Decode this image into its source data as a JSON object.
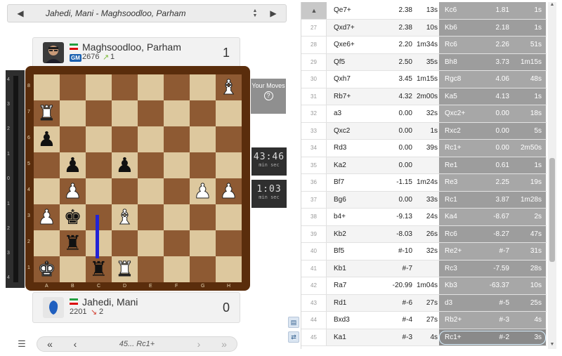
{
  "header": {
    "title": "Jahedi, Mani - Maghsoodloo, Parham",
    "prev_icon": "triangle-left-icon",
    "next_icon": "triangle-right-icon"
  },
  "players": {
    "top": {
      "name": "Maghsoodloo, Parham",
      "title": "GM",
      "rating": "2676",
      "rating_change": "1",
      "score": "1",
      "change_color": "#7dbb3a"
    },
    "bottom": {
      "name": "Jahedi, Mani",
      "rating": "2201",
      "rating_change": "2",
      "score": "0",
      "change_color": "#d23c2c"
    }
  },
  "eval_bar": {
    "labels": [
      "4",
      "3",
      "2",
      "1",
      "0",
      "1",
      "2",
      "3",
      "4"
    ]
  },
  "board": {
    "files": [
      "A",
      "B",
      "C",
      "D",
      "E",
      "F",
      "G",
      "H"
    ],
    "ranks": [
      "8",
      "7",
      "6",
      "5",
      "4",
      "3",
      "2",
      "1"
    ],
    "pieces": [
      {
        "sq": "h8",
        "p": "♝",
        "c": "w"
      },
      {
        "sq": "a7",
        "p": "♜",
        "c": "w"
      },
      {
        "sq": "a6",
        "p": "♟",
        "c": "b"
      },
      {
        "sq": "b5",
        "p": "♟",
        "c": "b"
      },
      {
        "sq": "d5",
        "p": "♟",
        "c": "b"
      },
      {
        "sq": "b4",
        "p": "♟",
        "c": "w"
      },
      {
        "sq": "g4",
        "p": "♟",
        "c": "w"
      },
      {
        "sq": "h4",
        "p": "♟",
        "c": "w"
      },
      {
        "sq": "a3",
        "p": "♟",
        "c": "w"
      },
      {
        "sq": "b3",
        "p": "♚",
        "c": "b"
      },
      {
        "sq": "d3",
        "p": "♝",
        "c": "w"
      },
      {
        "sq": "b2",
        "p": "♜",
        "c": "b"
      },
      {
        "sq": "a1",
        "p": "♚",
        "c": "w"
      },
      {
        "sq": "c1",
        "p": "♜",
        "c": "b"
      },
      {
        "sq": "d1",
        "p": "♜",
        "c": "w"
      }
    ]
  },
  "your_moves": {
    "label": "Your Moves",
    "help": "?"
  },
  "clocks": [
    {
      "time": "43:46",
      "units": "min   sec"
    },
    {
      "time": "1:03",
      "units": "min   sec"
    }
  ],
  "bottom_nav": {
    "current": "45... Rc1+"
  },
  "moves": [
    {
      "n": "",
      "w": "Qe7+",
      "we": "2.38",
      "wt": "13s",
      "b": "Kc6",
      "be": "1.81",
      "bt": "1s"
    },
    {
      "n": "27",
      "w": "Qxd7+",
      "we": "2.38",
      "wt": "10s",
      "b": "Kb6",
      "be": "2.18",
      "bt": "1s"
    },
    {
      "n": "28",
      "w": "Qxe6+",
      "we": "2.20",
      "wt": "1m34s",
      "b": "Rc6",
      "be": "2.26",
      "bt": "51s"
    },
    {
      "n": "29",
      "w": "Qf5",
      "we": "2.50",
      "wt": "35s",
      "b": "Bh8",
      "be": "3.73",
      "bt": "1m15s"
    },
    {
      "n": "30",
      "w": "Qxh7",
      "we": "3.45",
      "wt": "1m15s",
      "b": "Rgc8",
      "be": "4.06",
      "bt": "48s"
    },
    {
      "n": "31",
      "w": "Rb7+",
      "we": "4.32",
      "wt": "2m00s",
      "b": "Ka5",
      "be": "4.13",
      "bt": "1s"
    },
    {
      "n": "32",
      "w": "a3",
      "we": "0.00",
      "wt": "32s",
      "b": "Qxc2+",
      "be": "0.00",
      "bt": "18s"
    },
    {
      "n": "33",
      "w": "Qxc2",
      "we": "0.00",
      "wt": "1s",
      "b": "Rxc2",
      "be": "0.00",
      "bt": "5s"
    },
    {
      "n": "34",
      "w": "Rd3",
      "we": "0.00",
      "wt": "39s",
      "b": "Rc1+",
      "be": "0.00",
      "bt": "2m50s"
    },
    {
      "n": "35",
      "w": "Ka2",
      "we": "0.00",
      "wt": "",
      "b": "Re1",
      "be": "0.61",
      "bt": "1s"
    },
    {
      "n": "36",
      "w": "Bf7",
      "we": "-1.15",
      "wt": "1m24s",
      "b": "Re3",
      "be": "2.25",
      "bt": "19s"
    },
    {
      "n": "37",
      "w": "Bg6",
      "we": "0.00",
      "wt": "33s",
      "b": "Rc1",
      "be": "3.87",
      "bt": "1m28s"
    },
    {
      "n": "38",
      "w": "b4+",
      "we": "-9.13",
      "wt": "24s",
      "b": "Ka4",
      "be": "-8.67",
      "bt": "2s"
    },
    {
      "n": "39",
      "w": "Kb2",
      "we": "-8.03",
      "wt": "26s",
      "b": "Rc6",
      "be": "-8.27",
      "bt": "47s"
    },
    {
      "n": "40",
      "w": "Bf5",
      "we": "#-10",
      "wt": "32s",
      "b": "Re2+",
      "be": "#-7",
      "bt": "31s"
    },
    {
      "n": "41",
      "w": "Kb1",
      "we": "#-7",
      "wt": "",
      "b": "Rc3",
      "be": "-7.59",
      "bt": "28s"
    },
    {
      "n": "42",
      "w": "Ra7",
      "we": "-20.99",
      "wt": "1m04s",
      "b": "Kb3",
      "be": "-63.37",
      "bt": "10s"
    },
    {
      "n": "43",
      "w": "Rd1",
      "we": "#-6",
      "wt": "27s",
      "b": "d3",
      "be": "#-5",
      "bt": "25s"
    },
    {
      "n": "44",
      "w": "Bxd3",
      "we": "#-4",
      "wt": "27s",
      "b": "Rb2+",
      "be": "#-3",
      "bt": "4s"
    },
    {
      "n": "45",
      "w": "Ka1",
      "we": "#-3",
      "wt": "4s",
      "b": "Rc1+",
      "be": "#-2",
      "bt": "3s"
    }
  ]
}
